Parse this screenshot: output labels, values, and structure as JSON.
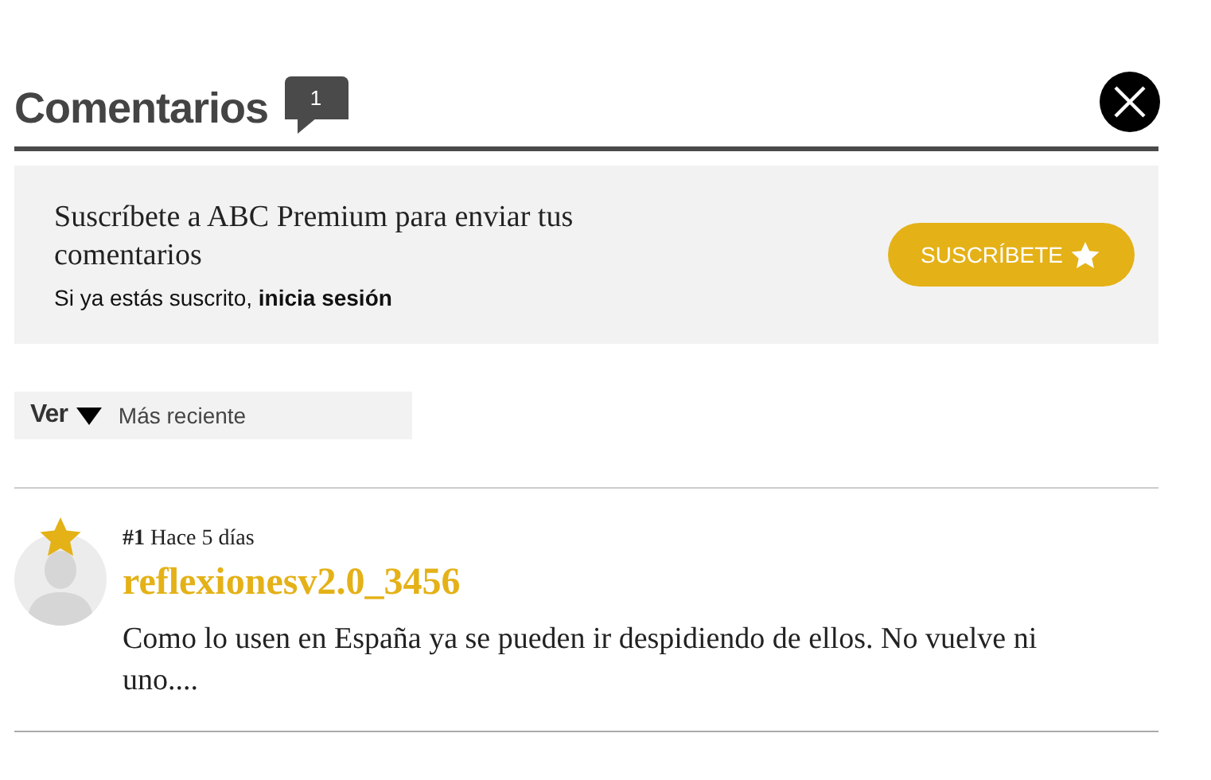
{
  "header": {
    "title": "Comentarios",
    "count": "1"
  },
  "subscribe": {
    "message": "Suscríbete a ABC Premium para enviar tus comentarios",
    "login_text": "Si ya estás suscrito, **inicia sesión**",
    "button": "SUSCRÍBETE"
  },
  "sort": {
    "label": "Ver",
    "value": "Más reciente"
  },
  "comments": [
    {
      "number": "#1",
      "time": "Hace 5 días",
      "author": "reflexionesv2.0_3456",
      "premium": true,
      "text": "Como lo usen en España ya se pueden ir despidiendo de ellos. No vuelve ni uno...."
    }
  ]
}
